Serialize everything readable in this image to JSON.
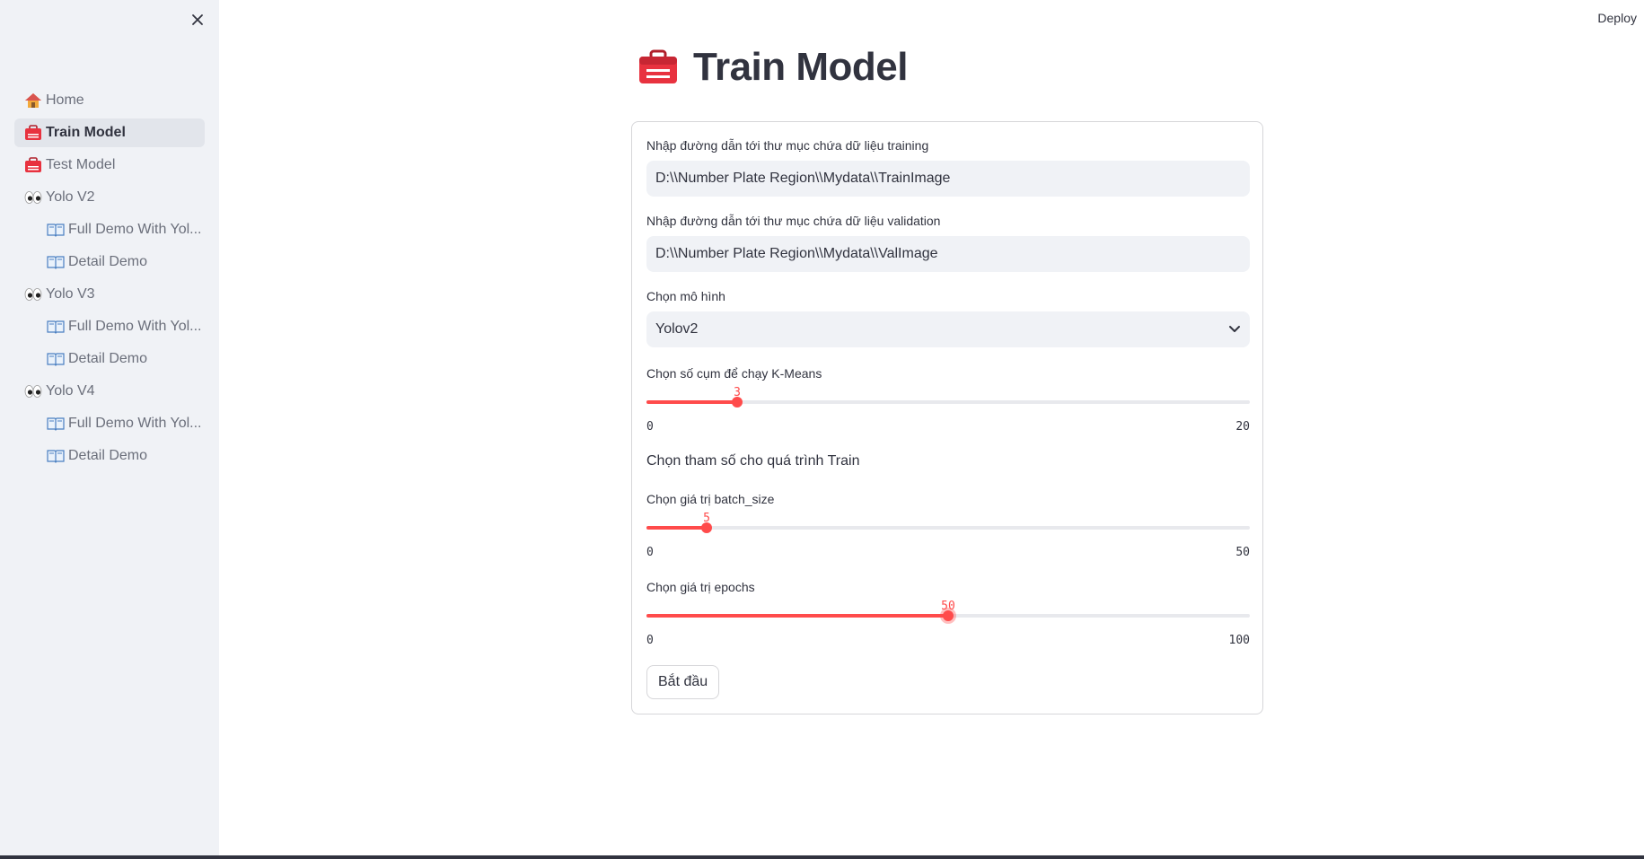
{
  "header": {
    "deploy_label": "Deploy"
  },
  "sidebar": {
    "items": [
      {
        "label": "Home",
        "icon": "house-icon",
        "active": false,
        "sub": false
      },
      {
        "label": "Train Model",
        "icon": "toolbox-icon",
        "active": true,
        "sub": false
      },
      {
        "label": "Test Model",
        "icon": "toolbox-icon",
        "active": false,
        "sub": false
      },
      {
        "label": "Yolo V2",
        "icon": "eyes-icon",
        "active": false,
        "sub": false
      },
      {
        "label": "Full Demo With Yol...",
        "icon": "book-icon",
        "active": false,
        "sub": true
      },
      {
        "label": "Detail Demo",
        "icon": "book-icon",
        "active": false,
        "sub": true
      },
      {
        "label": "Yolo V3",
        "icon": "eyes-icon",
        "active": false,
        "sub": false
      },
      {
        "label": "Full Demo With Yol...",
        "icon": "book-icon",
        "active": false,
        "sub": true
      },
      {
        "label": "Detail Demo",
        "icon": "book-icon",
        "active": false,
        "sub": true
      },
      {
        "label": "Yolo V4",
        "icon": "eyes-icon",
        "active": false,
        "sub": false
      },
      {
        "label": "Full Demo With Yol...",
        "icon": "book-icon",
        "active": false,
        "sub": true
      },
      {
        "label": "Detail Demo",
        "icon": "book-icon",
        "active": false,
        "sub": true
      }
    ]
  },
  "main": {
    "title": "Train Model",
    "train_path_label": "Nhập đường dẫn tới thư mục chứa dữ liệu training",
    "train_path_value": "D:\\\\Number Plate Region\\\\Mydata\\\\TrainImage",
    "val_path_label": "Nhập đường dẫn tới thư mục chứa dữ liệu validation",
    "val_path_value": "D:\\\\Number Plate Region\\\\Mydata\\\\ValImage",
    "model_label": "Chọn mô hình",
    "model_value": "Yolov2",
    "kmeans": {
      "label": "Chọn số cụm để chạy K-Means",
      "value": 3,
      "min": 0,
      "max": 20
    },
    "train_params_heading": "Chọn tham số cho quá trình Train",
    "batch_size": {
      "label": "Chọn giá trị batch_size",
      "value": 5,
      "min": 0,
      "max": 50
    },
    "epochs": {
      "label": "Chọn giá trị epochs",
      "value": 50,
      "min": 0,
      "max": 100
    },
    "start_button": "Bắt đầu"
  },
  "colors": {
    "accent": "#ff4b4b",
    "sidebar_bg": "#f0f2f6",
    "text": "#31333f"
  }
}
